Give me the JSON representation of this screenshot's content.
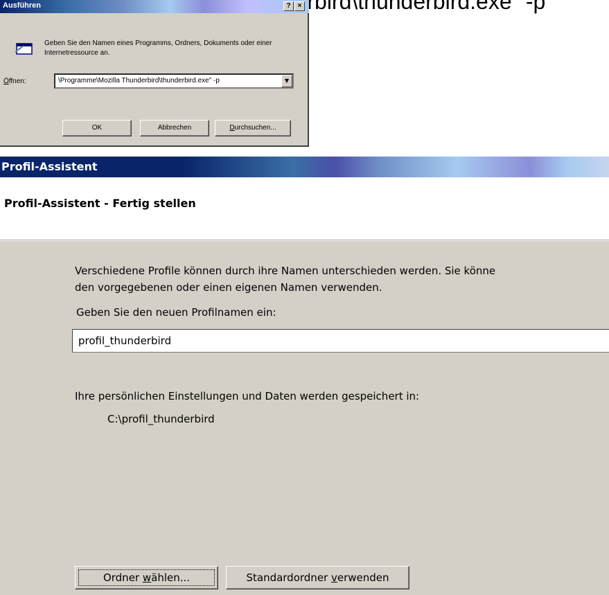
{
  "caption": {
    "text": "C:\\Programme\\Mozilla Thunderbird\\thunderbird.exe\" -p"
  },
  "run_dialog": {
    "title": "Ausführen",
    "help_btn": "?",
    "close_btn": "×",
    "icon": "run-program-icon",
    "description": "Geben Sie den Namen eines Programms, Ordners, Dokuments oder einer Internetressource an.",
    "open_label_prefix": "Ö",
    "open_label_rest": "ffnen:",
    "open_value": "\\Programme\\Mozilla Thunderbird\\thunderbird.exe\" -p",
    "ok": "OK",
    "cancel": "Abbrechen",
    "browse_prefix": "D",
    "browse_rest": "urchsuchen..."
  },
  "profile_assistant": {
    "title": "Profil-Assistent",
    "heading": "Profil-Assistent - Fertig stellen",
    "intro_line1": "Verschiedene Profile können durch ihre Namen unterschieden werden. Sie könne",
    "intro_line2": "den vorgegebenen oder einen eigenen Namen verwenden.",
    "name_prompt": "Geben Sie den neuen Profilnamen ein:",
    "profile_name": "profil_thunderbird",
    "storage_label": "Ihre persönlichen Einstellungen und Daten werden gespeichert in:",
    "storage_path": "C:\\profil_thunderbird",
    "choose_folder_a": "Ordner ",
    "choose_folder_u": "w",
    "choose_folder_b": "ählen...",
    "default_folder_a": "Standardordner ",
    "default_folder_u": "v",
    "default_folder_b": "erwenden"
  },
  "colors": {
    "window_face": "#d4d0c8",
    "titlebar_active": "#0a246a"
  }
}
